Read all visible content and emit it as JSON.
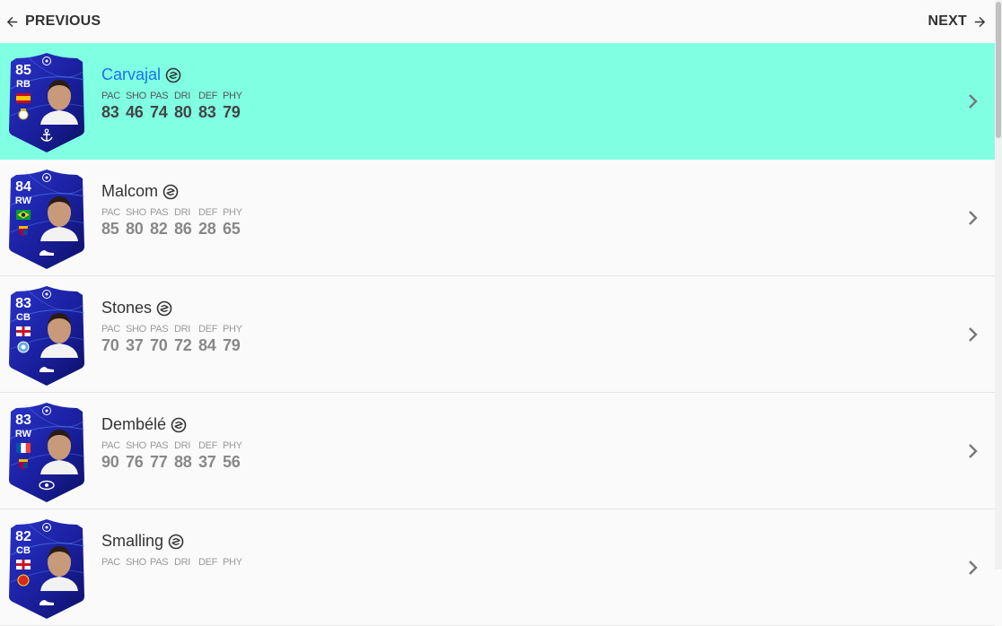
{
  "nav": {
    "previous_label": "PREVIOUS",
    "next_label": "NEXT"
  },
  "colors": {
    "selected_row": "#80ffe3",
    "card_blue": "#1a1f9e",
    "card_dark": "#0d1166",
    "name_selected": "#1a73e8"
  },
  "stat_labels": [
    "PAC",
    "SHO",
    "PAS",
    "DRI",
    "DEF",
    "PHY"
  ],
  "players": [
    {
      "name": "Carvajal",
      "rating": "85",
      "position": "RB",
      "flag": "spain",
      "club": "real-madrid",
      "chem_style": "anchor-icon",
      "stats": [
        "83",
        "46",
        "74",
        "80",
        "83",
        "79"
      ],
      "selected": true
    },
    {
      "name": "Malcom",
      "rating": "84",
      "position": "RW",
      "flag": "brazil",
      "club": "barcelona",
      "chem_style": "boot-icon",
      "stats": [
        "85",
        "80",
        "82",
        "86",
        "28",
        "65"
      ],
      "selected": false
    },
    {
      "name": "Stones",
      "rating": "83",
      "position": "CB",
      "flag": "england",
      "club": "manchester-city",
      "chem_style": "boot-icon",
      "stats": [
        "70",
        "37",
        "70",
        "72",
        "84",
        "79"
      ],
      "selected": false
    },
    {
      "name": "Dembélé",
      "rating": "83",
      "position": "RW",
      "flag": "france",
      "club": "barcelona",
      "chem_style": "eye-icon",
      "stats": [
        "90",
        "76",
        "77",
        "88",
        "37",
        "56"
      ],
      "selected": false
    },
    {
      "name": "Smalling",
      "rating": "82",
      "position": "CB",
      "flag": "england",
      "club": "manchester-united",
      "chem_style": "boot-icon",
      "stats": [
        "",
        "",
        "",
        "",
        "",
        ""
      ],
      "selected": false
    }
  ]
}
